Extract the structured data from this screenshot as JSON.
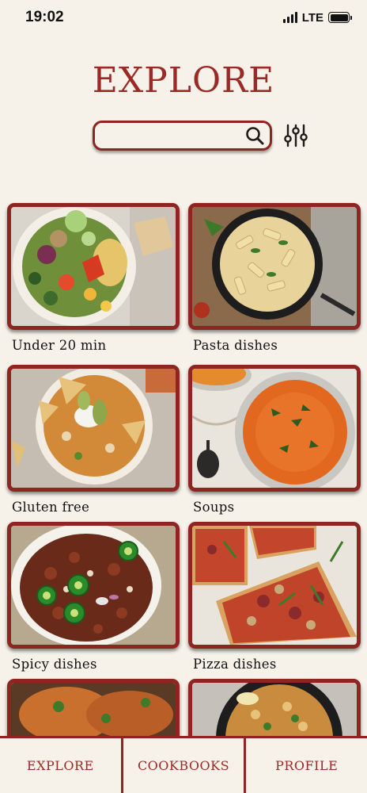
{
  "status_bar": {
    "time": "19:02",
    "network": "LTE"
  },
  "header": {
    "title": "EXPLORE"
  },
  "search": {
    "placeholder": "",
    "value": ""
  },
  "categories": [
    {
      "label": "Under 20 min"
    },
    {
      "label": "Pasta dishes"
    },
    {
      "label": "Gluten free"
    },
    {
      "label": "Soups"
    },
    {
      "label": "Spicy dishes"
    },
    {
      "label": "Pizza dishes"
    },
    {
      "label": ""
    },
    {
      "label": ""
    }
  ],
  "bottom_nav": {
    "items": [
      {
        "label": "EXPLORE"
      },
      {
        "label": "COOKBOOKS"
      },
      {
        "label": "PROFILE"
      }
    ]
  },
  "colors": {
    "accent": "#9a2a25",
    "border": "#8f2521",
    "background": "#f6f2ea"
  }
}
